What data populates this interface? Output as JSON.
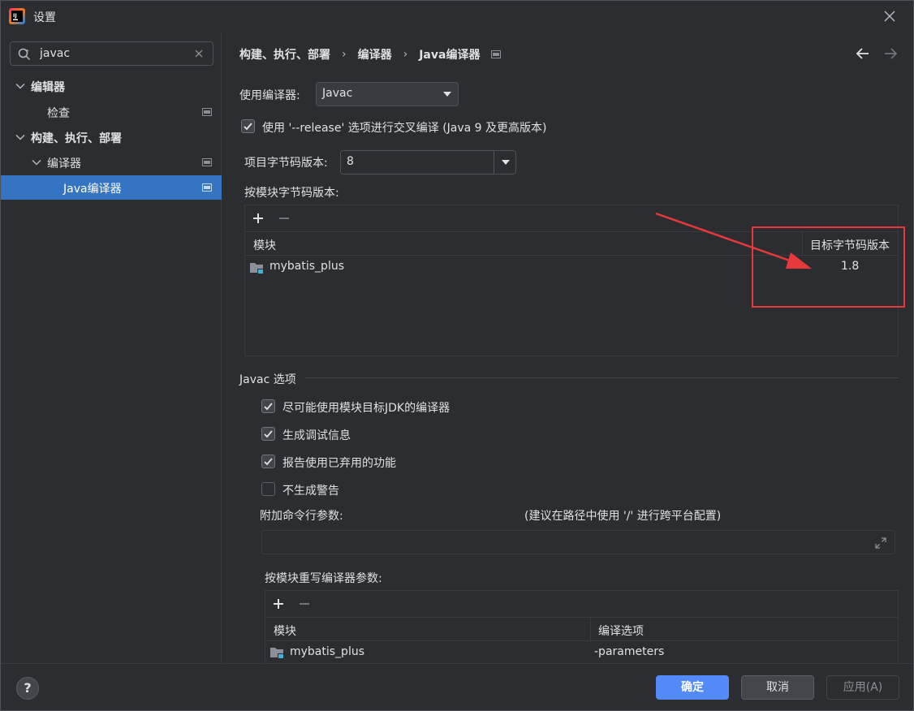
{
  "window": {
    "title": "设置",
    "close_icon": "close-icon",
    "logo_icon": "intellij-logo-icon"
  },
  "sidebar": {
    "search": {
      "value": "javac",
      "placeholder": ""
    },
    "items": [
      {
        "label": "编辑器",
        "level": 0,
        "expanded": true,
        "bold": true
      },
      {
        "label": "检查",
        "level": 1,
        "has_badge": true
      },
      {
        "label": "构建、执行、部署",
        "level": 0,
        "expanded": true,
        "bold": true
      },
      {
        "label": "编译器",
        "level": 1,
        "expanded": true,
        "has_badge": true
      },
      {
        "label": "Java编译器",
        "level": 2,
        "selected": true,
        "has_badge": true
      }
    ]
  },
  "breadcrumb": {
    "items": [
      "构建、执行、部署",
      "编译器",
      "Java编译器"
    ],
    "sep": "›"
  },
  "compiler": {
    "use_compiler_label": "使用编译器:",
    "use_compiler_value": "Javac",
    "release_option_label": "使用 '--release' 选项进行交叉编译 (Java 9 及更高版本)",
    "release_option_checked": true,
    "project_bytecode_label": "项目字节码版本:",
    "project_bytecode_value": "8",
    "per_module_bytecode_label": "按模块字节码版本:"
  },
  "module_bytecode_table": {
    "add_icon": "plus-icon",
    "remove_icon": "minus-icon",
    "headers": [
      "模块",
      "目标字节码版本"
    ],
    "rows": [
      {
        "module": "mybatis_plus",
        "target": "1.8"
      }
    ]
  },
  "javac_options": {
    "section_title": "Javac 选项",
    "options": [
      {
        "label": "尽可能使用模块目标JDK的编译器",
        "checked": true
      },
      {
        "label": "生成调试信息",
        "checked": true
      },
      {
        "label": "报告使用已弃用的功能",
        "checked": true
      },
      {
        "label": "不生成警告",
        "checked": false
      }
    ],
    "extra_args_label": "附加命令行参数:",
    "extra_args_hint": "(建议在路径中使用 '/' 进行跨平台配置)",
    "extra_args_value": "",
    "override_label": "按模块重写编译器参数:"
  },
  "override_table": {
    "headers": [
      "模块",
      "编译选项"
    ],
    "rows": [
      {
        "module": "mybatis_plus",
        "options": "-parameters"
      }
    ]
  },
  "footer": {
    "help": "?",
    "ok": "确定",
    "cancel": "取消",
    "apply": "应用(A)"
  },
  "colors": {
    "accent": "#548af7",
    "selection": "#3574c3",
    "annotation_red": "#e8393a",
    "background": "#2b2d30"
  }
}
